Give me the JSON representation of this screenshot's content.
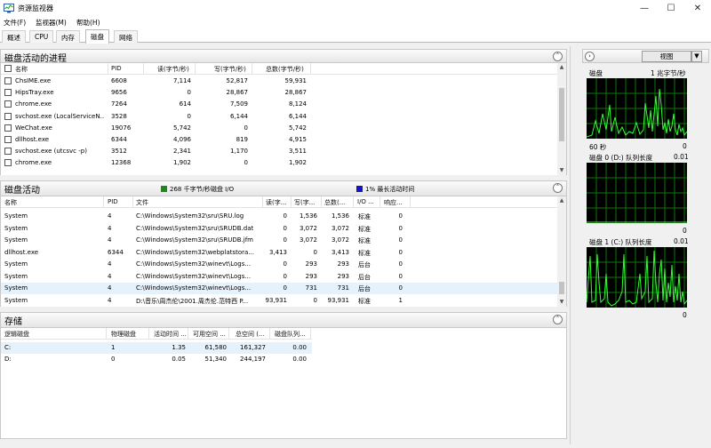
{
  "window": {
    "title": "资源监视器",
    "minimize": "—",
    "maximize": "☐",
    "close": "✕"
  },
  "menu": [
    "文件(F)",
    "监视器(M)",
    "帮助(H)"
  ],
  "tabs": [
    "概述",
    "CPU",
    "内存",
    "磁盘",
    "网络"
  ],
  "active_tab": "磁盘",
  "processes": {
    "title": "磁盘活动的进程",
    "columns": [
      "名称",
      "PID",
      "读(字节/秒)",
      "写(字节/秒)",
      "总数(字节/秒)"
    ],
    "rows": [
      [
        "ChsIME.exe",
        "6608",
        "7,114",
        "52,817",
        "59,931"
      ],
      [
        "HipsTray.exe",
        "9656",
        "0",
        "28,867",
        "28,867"
      ],
      [
        "chrome.exe",
        "7264",
        "614",
        "7,509",
        "8,124"
      ],
      [
        "svchost.exe (LocalServiceN...",
        "3528",
        "0",
        "6,144",
        "6,144"
      ],
      [
        "WeChat.exe",
        "19076",
        "5,742",
        "0",
        "5,742"
      ],
      [
        "dllhost.exe",
        "6344",
        "4,096",
        "819",
        "4,915"
      ],
      [
        "svchost.exe (utcsvc -p)",
        "3512",
        "2,341",
        "1,170",
        "3,511"
      ],
      [
        "chrome.exe",
        "12368",
        "1,902",
        "0",
        "1,902"
      ]
    ]
  },
  "activity": {
    "title": "磁盘活动",
    "io_text": "268 千字节/秒磁盘 I/O",
    "active_text": "1% 最长活动时间",
    "io_color": "#1a8a1a",
    "active_color": "#1515b8",
    "columns": [
      "名称",
      "PID",
      "文件",
      "读(字...",
      "写(字...",
      "总数(...",
      "I/O ...",
      "响应..."
    ],
    "rows": [
      [
        "System",
        "4",
        "C:\\Windows\\System32\\sru\\SRU.log",
        "0",
        "1,536",
        "1,536",
        "标准",
        "0"
      ],
      [
        "System",
        "4",
        "C:\\Windows\\System32\\sru\\SRUDB.dat",
        "0",
        "3,072",
        "3,072",
        "标准",
        "0"
      ],
      [
        "System",
        "4",
        "C:\\Windows\\System32\\sru\\SRUDB.jfm",
        "0",
        "3,072",
        "3,072",
        "标准",
        "0"
      ],
      [
        "dllhost.exe",
        "6344",
        "C:\\Windows\\System32\\webplatstora...",
        "3,413",
        "0",
        "3,413",
        "标准",
        "0"
      ],
      [
        "System",
        "4",
        "C:\\Windows\\System32\\winevt\\Logs...",
        "0",
        "293",
        "293",
        "后台",
        "0"
      ],
      [
        "System",
        "4",
        "C:\\Windows\\System32\\winevt\\Logs...",
        "0",
        "293",
        "293",
        "后台",
        "0"
      ],
      [
        "System",
        "4",
        "C:\\Windows\\System32\\winevt\\Logs...",
        "0",
        "731",
        "731",
        "后台",
        "0"
      ],
      [
        "System",
        "4",
        "D:\\音乐\\周杰伦\\2001.周杰伦.范特西 P...",
        "93,931",
        "0",
        "93,931",
        "标准",
        "1"
      ]
    ]
  },
  "storage": {
    "title": "存储",
    "columns": [
      "逻辑磁盘",
      "物理磁盘",
      "活动时间 ...",
      "可用空间 ...",
      "总空间 (...",
      "磁盘队列..."
    ],
    "rows": [
      [
        "C:",
        "1",
        "1.35",
        "61,580",
        "161,327",
        "0.00"
      ],
      [
        "D:",
        "0",
        "0.05",
        "51,340",
        "244,197",
        "0.00"
      ]
    ]
  },
  "right_pane": {
    "view_label": "视图",
    "graphs": [
      {
        "title": "磁盘",
        "top_right": "1 兆字节/秒",
        "bottom_left": "60 秒",
        "bottom_right": "0"
      },
      {
        "title": "磁盘 0 (D:) 队列长度",
        "top_right": "0.01",
        "bottom_left": "",
        "bottom_right": "0"
      },
      {
        "title": "磁盘 1 (C:) 队列长度",
        "top_right": "0.01",
        "bottom_left": "",
        "bottom_right": "0"
      }
    ]
  },
  "colors": {
    "graph_line": "#33ff33",
    "graph_grid": "#0a7a0a",
    "graph_bg": "#000000"
  }
}
